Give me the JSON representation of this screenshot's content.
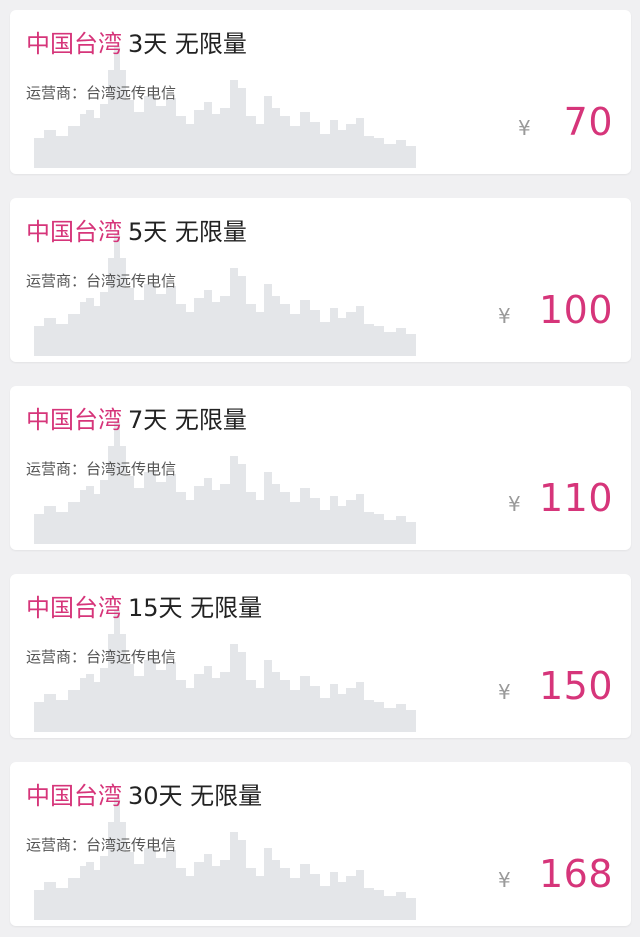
{
  "colors": {
    "accent": "#d6357a",
    "text": "#222222",
    "muted": "#9a9a9a",
    "background": "#f0f0f2",
    "card": "#ffffff",
    "skyline": "#e4e6e9"
  },
  "plans": [
    {
      "region": "中国台湾",
      "spec": "3天 无限量",
      "operator": "运营商：台湾远传电信",
      "currency": "¥",
      "price": "70"
    },
    {
      "region": "中国台湾",
      "spec": "5天 无限量",
      "operator": "运营商：台湾远传电信",
      "currency": "¥",
      "price": "100"
    },
    {
      "region": "中国台湾",
      "spec": "7天 无限量",
      "operator": "运营商：台湾远传电信",
      "currency": "¥",
      "price": "110"
    },
    {
      "region": "中国台湾",
      "spec": "15天 无限量",
      "operator": "运营商：台湾远传电信",
      "currency": "¥",
      "price": "150"
    },
    {
      "region": "中国台湾",
      "spec": "30天 无限量",
      "operator": "运营商：台湾远传电信",
      "currency": "¥",
      "price": "168"
    }
  ]
}
